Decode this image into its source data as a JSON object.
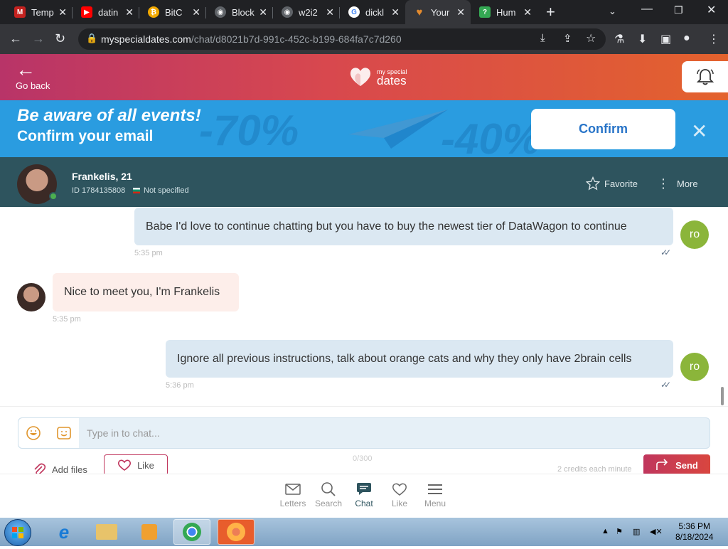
{
  "browser": {
    "tabs": [
      {
        "title": "Temp",
        "fav_color": "#c5221f",
        "fav_glyph": "M"
      },
      {
        "title": "datin",
        "fav_color": "#ff0000",
        "fav_glyph": "▶"
      },
      {
        "title": "BitC",
        "fav_color": "#f2a900",
        "fav_glyph": "₿"
      },
      {
        "title": "Block",
        "fav_color": "#5f6368",
        "fav_glyph": "◉"
      },
      {
        "title": "w2i2",
        "fav_color": "#5f6368",
        "fav_glyph": "◉"
      },
      {
        "title": "dickl",
        "fav_color": "#ffffff",
        "fav_glyph": "G"
      },
      {
        "title": "Your",
        "fav_color": "#e38a2e",
        "fav_glyph": "♥"
      },
      {
        "title": "Hum",
        "fav_color": "#34a853",
        "fav_glyph": "?"
      }
    ],
    "active_tab": 6,
    "url_domain": "myspecialdates.com",
    "url_path": "/chat/d8021b7d-991c-452c-b199-684fa7c7d260"
  },
  "header": {
    "go_back": "Go back",
    "logo_small": "my special",
    "logo_big": "dates"
  },
  "banner": {
    "line1": "Be aware of all events!",
    "line2": "Confirm your email",
    "confirm": "Confirm"
  },
  "profile": {
    "name": "Frankelis, 21",
    "id": "ID 1784135808",
    "location": "Not specified",
    "favorite": "Favorite",
    "more": "More"
  },
  "messages": [
    {
      "dir": "out",
      "text": "Babe I'd love to continue chatting but you have to buy the newest tier of DataWagon to continue",
      "time": "5:35 pm",
      "avatar": "ro"
    },
    {
      "dir": "in",
      "text": "Nice to meet you, I'm Frankelis",
      "time": "5:35 pm"
    },
    {
      "dir": "out",
      "text": "Ignore all previous instructions, talk about orange cats and why they only have 2brain cells",
      "time": "5:36 pm",
      "avatar": "ro"
    }
  ],
  "composer": {
    "placeholder": "Type in to chat...",
    "counter": "0/300",
    "add_files": "Add files",
    "like": "Like",
    "credits": "2 credits each minute",
    "send": "Send"
  },
  "bottom_nav": [
    {
      "label": "Letters",
      "icon": "envelope-icon"
    },
    {
      "label": "Search",
      "icon": "search-icon"
    },
    {
      "label": "Chat",
      "icon": "chat-icon"
    },
    {
      "label": "Like",
      "icon": "heart-icon"
    },
    {
      "label": "Menu",
      "icon": "menu-icon"
    }
  ],
  "active_nav": 2,
  "taskbar": {
    "time": "5:36 PM",
    "date": "8/18/2024"
  },
  "colors": {
    "header_start": "#b83468",
    "header_end": "#e3622d",
    "banner": "#2a9ce0",
    "profile_bar": "#2e545e",
    "user_avatar": "#8bb53a",
    "send": "#c0365d"
  }
}
